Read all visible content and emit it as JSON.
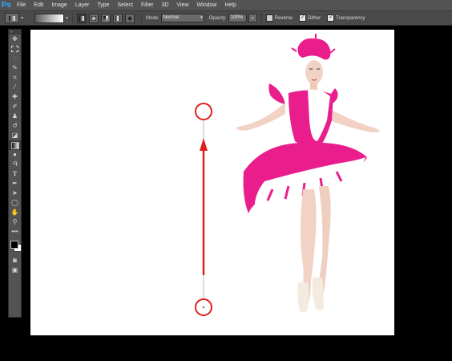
{
  "app": {
    "logo": "Ps"
  },
  "menu": [
    "File",
    "Edit",
    "Image",
    "Layer",
    "Type",
    "Select",
    "Filter",
    "3D",
    "View",
    "Window",
    "Help"
  ],
  "options": {
    "mode_label": "Mode:",
    "mode_value": "Normal",
    "opacity_label": "Opacity:",
    "opacity_value": "100%",
    "reverse_label": "Reverse",
    "dither_label": "Dither",
    "transparency_label": "Transparency",
    "reverse_checked": false,
    "dither_checked": true,
    "transparency_checked": true
  },
  "toolbox": {
    "header": "»",
    "tools": [
      "move",
      "marquee",
      "lasso",
      "quick-selection",
      "crop",
      "eyedropper",
      "spot-healing",
      "brush",
      "clone-stamp",
      "history-brush",
      "eraser",
      "gradient",
      "blur",
      "dodge",
      "pen",
      "type",
      "path-selection",
      "rectangle",
      "hand",
      "zoom",
      "more"
    ],
    "selected": "gradient"
  },
  "colors": {
    "foreground": "#000000",
    "background": "#ffffff",
    "guide": "#e02020",
    "costume": "#e91e8c"
  }
}
